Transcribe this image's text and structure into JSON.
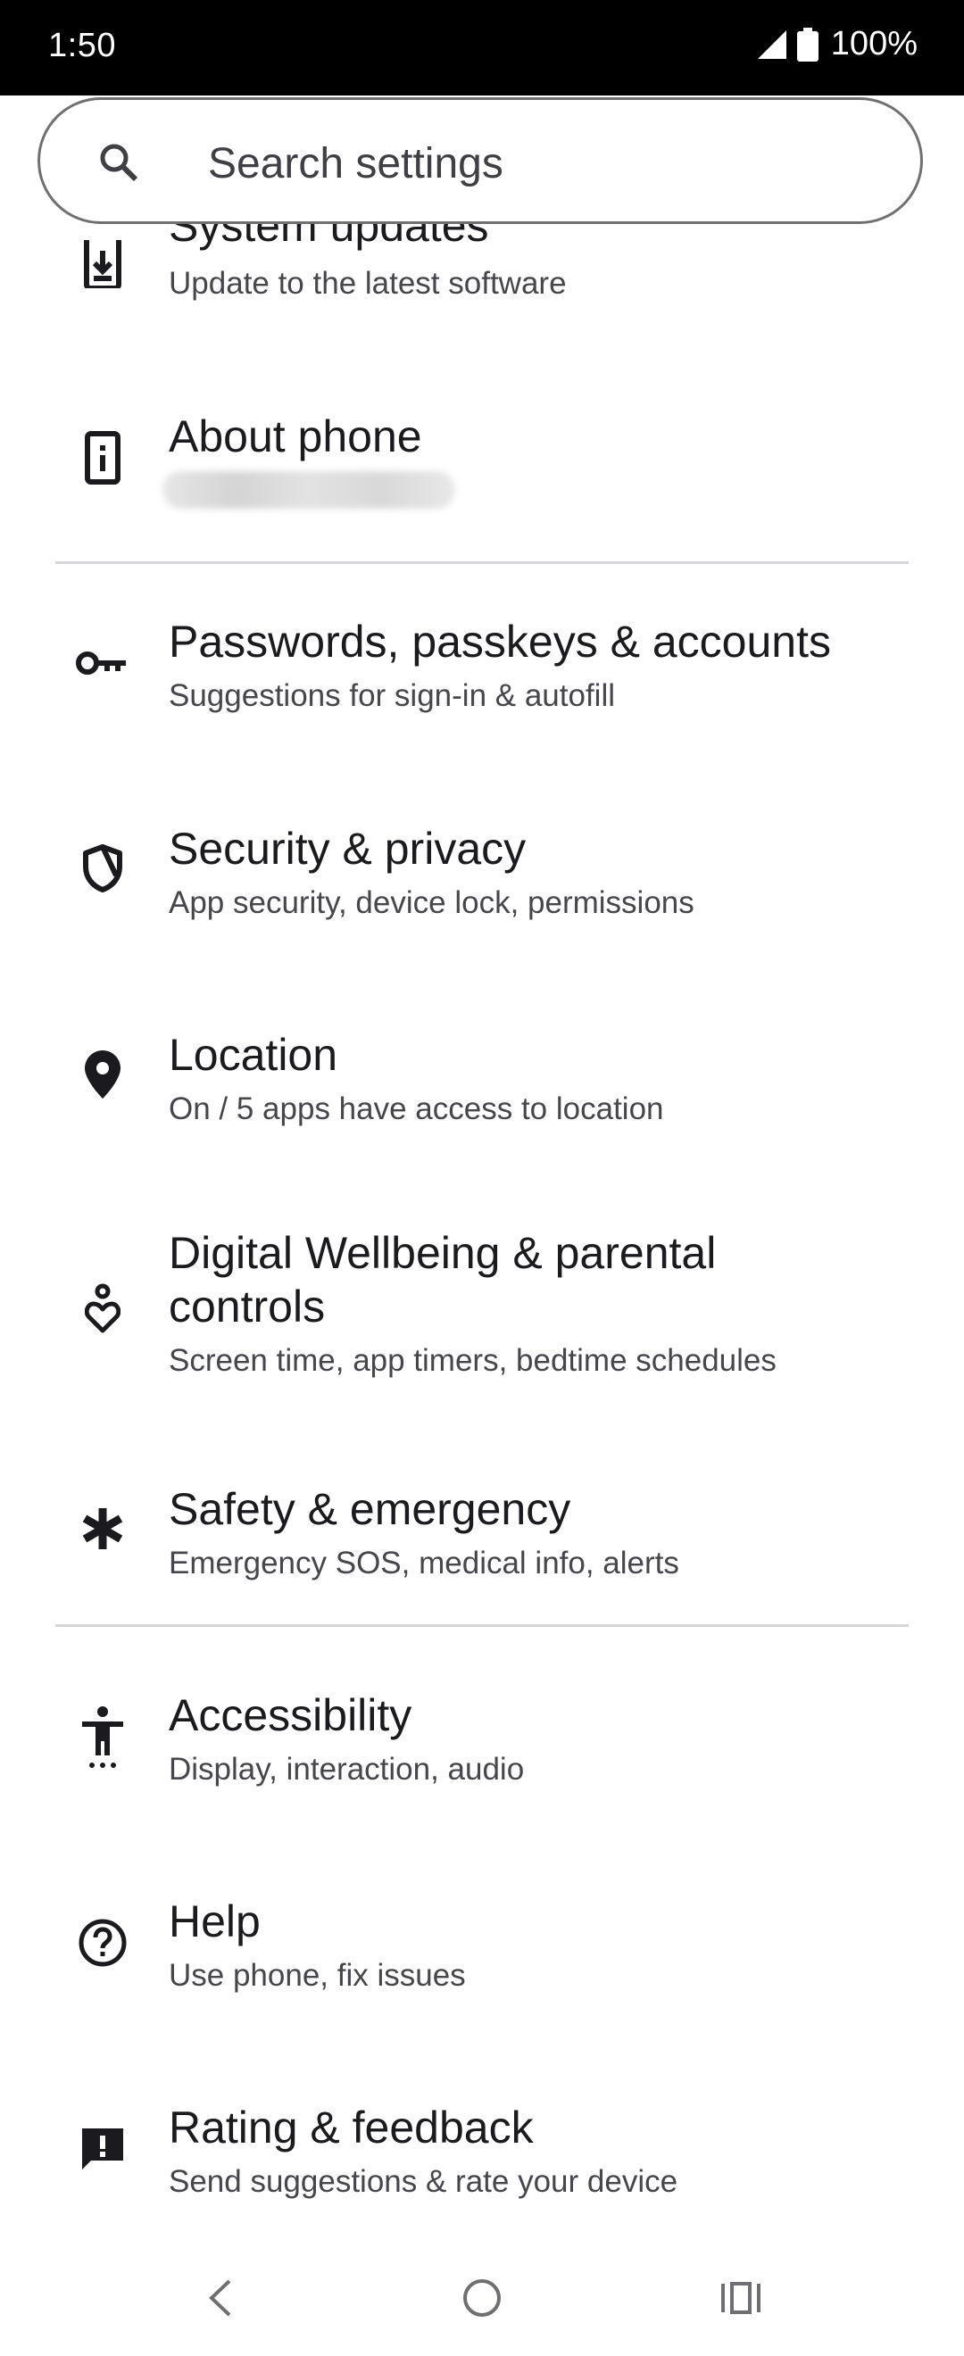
{
  "status_bar": {
    "time": "1:50",
    "battery": "100%"
  },
  "search": {
    "placeholder": "Search settings"
  },
  "items": [
    {
      "title": "System updates",
      "subtitle": "Update to the latest software",
      "icon": "system-update-icon"
    },
    {
      "title": "About phone",
      "subtitle": "",
      "icon": "about-phone-icon"
    },
    {
      "title": "Passwords, passkeys & accounts",
      "subtitle": "Suggestions for sign-in & autofill",
      "icon": "key-icon"
    },
    {
      "title": "Security & privacy",
      "subtitle": "App security, device lock, permissions",
      "icon": "shield-icon"
    },
    {
      "title": "Location",
      "subtitle": "On / 5 apps have access to location",
      "icon": "location-pin-icon"
    },
    {
      "title_line1": "Digital Wellbeing & parental",
      "title_line2": "controls",
      "subtitle": "Screen time, app timers, bedtime schedules",
      "icon": "wellbeing-icon"
    },
    {
      "title": "Safety & emergency",
      "subtitle": "Emergency SOS, medical info, alerts",
      "icon": "asterisk-icon"
    },
    {
      "title": "Accessibility",
      "subtitle": "Display, interaction, audio",
      "icon": "accessibility-icon"
    },
    {
      "title": "Help",
      "subtitle": "Use phone, fix issues",
      "icon": "help-icon"
    },
    {
      "title": "Rating & feedback",
      "subtitle": "Send suggestions & rate your device",
      "icon": "feedback-icon"
    }
  ],
  "nav": {
    "back": "back-icon",
    "home": "home-icon",
    "recents": "recents-icon"
  }
}
